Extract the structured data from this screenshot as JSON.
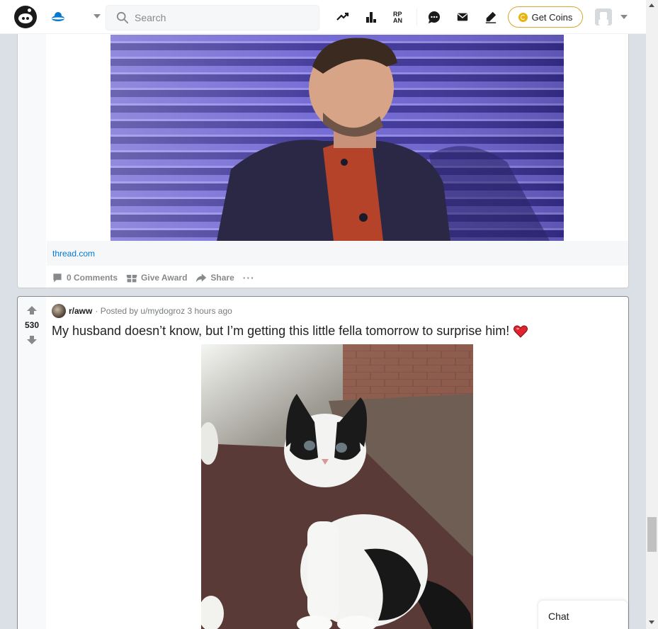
{
  "header": {
    "search_placeholder": "Search",
    "get_coins_label": "Get Coins",
    "icons": [
      "reddit-logo",
      "home-feed-icon",
      "trending-icon",
      "stats-icon",
      "rpan-icon",
      "chat-icon",
      "mail-icon",
      "create-post-icon",
      "coin-icon",
      "user-avatar"
    ]
  },
  "post1": {
    "link_domain": "thread.com",
    "actions": {
      "comments": "0 Comments",
      "award": "Give Award",
      "share": "Share",
      "more": "···"
    }
  },
  "post2": {
    "score": "530",
    "subreddit": "r/aww",
    "posted_by": "· Posted by u/mydogroz",
    "time": "3 hours ago",
    "title": "My husband doesn’t know, but I’m getting this little fella tomorrow to surprise him!"
  },
  "chat": {
    "label": "Chat"
  },
  "colors": {
    "link": "#0079d3",
    "coins_border": "#d4a72c",
    "background": "#dae0e6"
  }
}
